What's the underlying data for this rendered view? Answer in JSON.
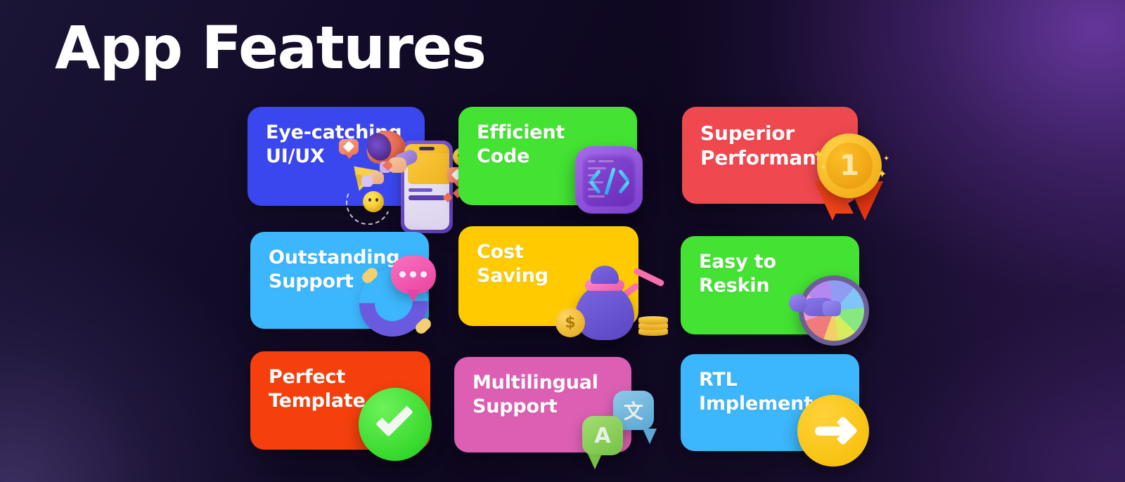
{
  "page": {
    "title": "App Features",
    "background_dark": "#100a24",
    "background_glow": "#6838a0"
  },
  "cards": [
    {
      "id": "eye-catching-ui-ux",
      "label": "Eye-catching\nUI/UX",
      "color": "#3B47EE",
      "icon": "megaphone-phone-social-icon"
    },
    {
      "id": "efficient-code",
      "label": "Efficient\nCode",
      "color": "#44E233",
      "icon": "code-brackets-icon"
    },
    {
      "id": "superior-performance",
      "label": "Superior\nPerformance",
      "color": "#F0484F",
      "icon": "first-place-medal-icon",
      "icon_text": "1"
    },
    {
      "id": "outstanding-support",
      "label": "Outstanding\nSupport",
      "color": "#3CB6FC",
      "icon": "phone-handset-chat-icon"
    },
    {
      "id": "cost-saving",
      "label": "Cost\nSaving",
      "color": "#FFCB00",
      "icon": "money-bag-down-arrow-icon",
      "icon_text": "$"
    },
    {
      "id": "easy-to-reskin",
      "label": "Easy to\nReskin",
      "color": "#44E233",
      "icon": "color-wheel-sprayer-icon"
    },
    {
      "id": "perfect-template",
      "label": "Perfect\nTemplate",
      "color": "#F5400D",
      "icon": "green-checkmark-icon"
    },
    {
      "id": "multilingual-support",
      "label": "Multilingual\nSupport",
      "color": "#DC5FB4",
      "icon": "language-chat-bubbles-icon",
      "icon_text_a": "A",
      "icon_text_b": "文"
    },
    {
      "id": "rtl-implemented",
      "label": "RTL\nImplemented",
      "color": "#3CB6FC",
      "icon": "right-arrow-circle-icon"
    }
  ]
}
